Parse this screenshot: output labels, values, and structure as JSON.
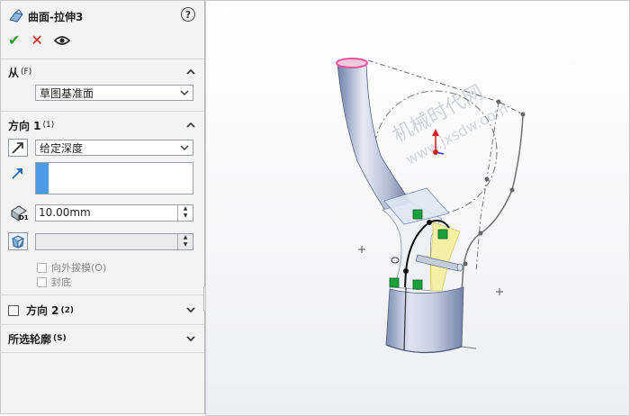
{
  "feature": {
    "title": "曲面-拉伸3",
    "help": "?"
  },
  "actions": {
    "ok_glyph": "✔",
    "cancel_glyph": "✕"
  },
  "from": {
    "title": "从",
    "shortcut": "(F)",
    "value": "草图基准面"
  },
  "direction1": {
    "title": "方向 1",
    "shortcut": "(1)",
    "end_condition": "给定深度",
    "depth": "10.00mm",
    "draft_outward": "向外拔模(O)",
    "cap_end": "封底"
  },
  "direction2": {
    "title": "方向 2",
    "shortcut": "(2)"
  },
  "selected_contours": {
    "title": "所选轮廓",
    "shortcut": "(S)"
  },
  "watermark": {
    "line1": "机械时代网",
    "line2": "www.jxsdw.com"
  },
  "colors": {
    "accent_blue": "#4c9be8",
    "ok_green": "#2a9a2a",
    "cancel_red": "#d42020",
    "highlight_pink": "#e8529a"
  }
}
